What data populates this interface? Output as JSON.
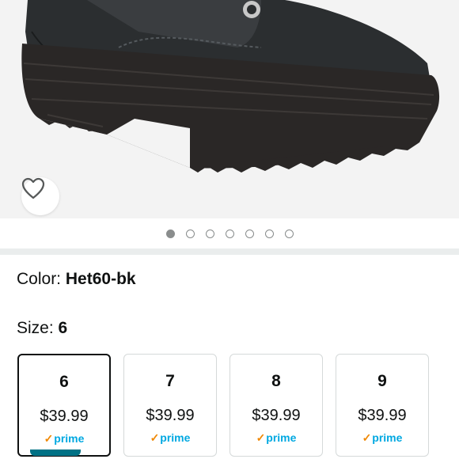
{
  "product": {
    "image_icon": "boot-image",
    "wishlist_icon": "heart-outline-icon",
    "carousel": {
      "total": 7,
      "active_index": 0
    }
  },
  "variation": {
    "color_label": "Color:",
    "color_value": "Het60-bk",
    "size_label": "Size:",
    "size_value": "6"
  },
  "sizes": [
    {
      "size": "6",
      "price": "$39.99",
      "prime": "prime",
      "selected": true
    },
    {
      "size": "7",
      "price": "$39.99",
      "prime": "prime",
      "selected": false
    },
    {
      "size": "8",
      "price": "$39.99",
      "prime": "prime",
      "selected": false
    },
    {
      "size": "9",
      "price": "$39.99",
      "prime": "prime",
      "selected": false
    }
  ],
  "colors": {
    "accent": "#007185",
    "prime_blue": "#00a8e1",
    "prime_orange": "#f08804",
    "background_gray": "#f3f3f3"
  }
}
